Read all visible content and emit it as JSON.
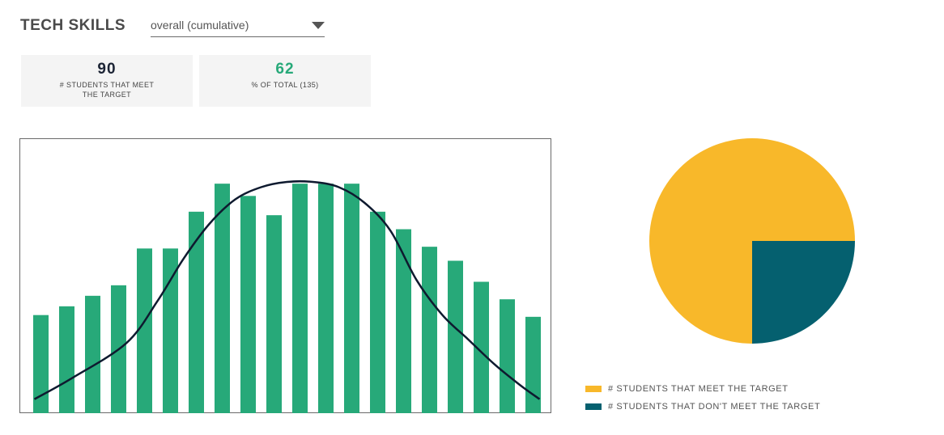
{
  "header": {
    "title": "TECH SKILLS"
  },
  "filter": {
    "selected": "overall (cumulative)"
  },
  "stats": [
    {
      "value": "90",
      "label": "# STUDENTS THAT MEET THE TARGET"
    },
    {
      "value": "62",
      "label": "% OF TOTAL (135)"
    }
  ],
  "colors": {
    "bar": "#27a979",
    "curve": "#0e1a2f",
    "meet": "#f8b82a",
    "not_meet": "#05606f"
  },
  "chart_data": [
    {
      "type": "bar",
      "values": [
        28,
        30.5,
        33.5,
        36.5,
        47,
        47,
        57.5,
        65.5,
        62,
        56.5,
        65.5,
        65.5,
        65.5,
        57.5,
        52.5,
        47.5,
        43.5,
        37.5,
        32.5,
        27.5
      ],
      "ylim": [
        0,
        75
      ],
      "trend_curve": [
        [
          -0.25,
          4
        ],
        [
          1.2,
          10
        ],
        [
          3.3,
          20
        ],
        [
          4.5,
          32
        ],
        [
          5.5,
          44
        ],
        [
          6.5,
          54
        ],
        [
          7.5,
          61
        ],
        [
          8.5,
          64.5
        ],
        [
          9.5,
          66
        ],
        [
          10.5,
          66
        ],
        [
          11.5,
          64.5
        ],
        [
          12.5,
          60
        ],
        [
          13.5,
          52
        ],
        [
          14.5,
          38
        ],
        [
          15.5,
          28
        ],
        [
          16.5,
          21
        ],
        [
          17.5,
          14
        ],
        [
          18.5,
          8
        ],
        [
          19.25,
          4
        ]
      ]
    },
    {
      "type": "pie",
      "labels": [
        "# STUDENTS THAT MEET THE TARGET",
        "# STUDENTS THAT DON'T MEET THE TARGET"
      ],
      "values": [
        75,
        25
      ],
      "legend_position": "bottom"
    }
  ]
}
